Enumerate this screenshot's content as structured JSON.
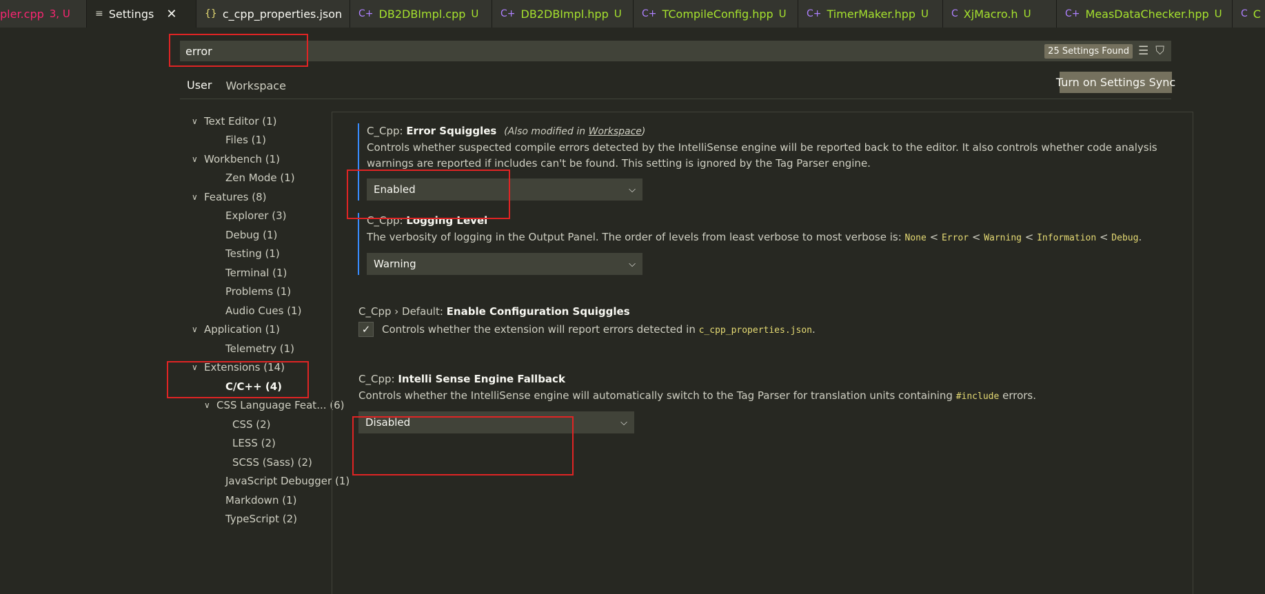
{
  "tabs": [
    {
      "name": "pler.cpp",
      "badge": "3, U",
      "icon": "",
      "color": "#f92672"
    },
    {
      "name": "Settings",
      "badge": "",
      "icon": "≡",
      "active": true
    },
    {
      "name": "c_cpp_properties.json",
      "badge": "",
      "icon": "{}",
      "color": "#f8f8f2"
    },
    {
      "name": "DB2DBImpl.cpp",
      "badge": "U",
      "icon": "C+"
    },
    {
      "name": "DB2DBImpl.hpp",
      "badge": "U",
      "icon": "C+"
    },
    {
      "name": "TCompileConfig.hpp",
      "badge": "U",
      "icon": "C+"
    },
    {
      "name": "TimerMaker.hpp",
      "badge": "U",
      "icon": "C+"
    },
    {
      "name": "XjMacro.h",
      "badge": "U",
      "icon": "C"
    },
    {
      "name": "MeasDataChecker.hpp",
      "badge": "U",
      "icon": "C+"
    },
    {
      "name": "C",
      "badge": "",
      "icon": "C"
    }
  ],
  "search": {
    "value": "error",
    "found": "25 Settings Found"
  },
  "scope": {
    "user": "User",
    "workspace": "Workspace"
  },
  "sync_button": "Turn on Settings Sync",
  "toc": [
    {
      "label": "Text Editor (1)",
      "chev": "∨"
    },
    {
      "label": "Files (1)"
    },
    {
      "label": "Workbench (1)",
      "chev": "∨"
    },
    {
      "label": "Zen Mode (1)"
    },
    {
      "label": "Features (8)",
      "chev": "∨"
    },
    {
      "label": "Explorer (3)"
    },
    {
      "label": "Debug (1)"
    },
    {
      "label": "Testing (1)"
    },
    {
      "label": "Terminal (1)"
    },
    {
      "label": "Problems (1)"
    },
    {
      "label": "Audio Cues (1)"
    },
    {
      "label": "Application (1)",
      "chev": "∨"
    },
    {
      "label": "Telemetry (1)"
    },
    {
      "label": "Extensions (14)",
      "chev": "∨"
    },
    {
      "label": "C/C++ (4)",
      "selected": true
    },
    {
      "label": "CSS Language Feat... (6)",
      "chev": "∨"
    },
    {
      "label": "CSS (2)"
    },
    {
      "label": "LESS (2)"
    },
    {
      "label": "SCSS (Sass) (2)"
    },
    {
      "label": "JavaScript Debugger (1)"
    },
    {
      "label": "Markdown (1)"
    },
    {
      "label": "TypeScript (2)"
    }
  ],
  "settings": {
    "error_squiggles": {
      "prefix": "C_Cpp: ",
      "title": "Error Squiggles",
      "mod_prefix": "(Also modified in ",
      "mod_link": "Workspace",
      "mod_suffix": ")",
      "desc": "Controls whether suspected compile errors detected by the IntelliSense engine will be reported back to the editor. It also controls whether code analysis warnings are reported if includes can't be found. This setting is ignored by the Tag Parser engine.",
      "value": "Enabled"
    },
    "logging_level": {
      "prefix": "C_Cpp: ",
      "title": "Logging Level",
      "desc": "The verbosity of logging in the Output Panel. The order of levels from least verbose to most verbose is: ",
      "levels": [
        "None",
        "Error",
        "Warning",
        "Information",
        "Debug"
      ],
      "sep": " < ",
      "end": ".",
      "value": "Warning"
    },
    "config_squiggles": {
      "prefix": "C_Cpp › Default: ",
      "title": "Enable Configuration Squiggles",
      "desc": "Controls whether the extension will report errors detected in ",
      "code": "c_cpp_properties.json",
      "end": ".",
      "checked": "✓"
    },
    "engine_fallback": {
      "prefix": "C_Cpp: ",
      "title": "Intelli Sense Engine Fallback",
      "desc_a": "Controls whether the IntelliSense engine will automatically switch to the Tag Parser for translation units containing ",
      "code": "#include",
      "desc_b": " errors.",
      "value": "Disabled"
    }
  },
  "colors": {
    "background": "#272822",
    "accent_annotation": "#e02424",
    "modified_bar": "#388bfd"
  }
}
